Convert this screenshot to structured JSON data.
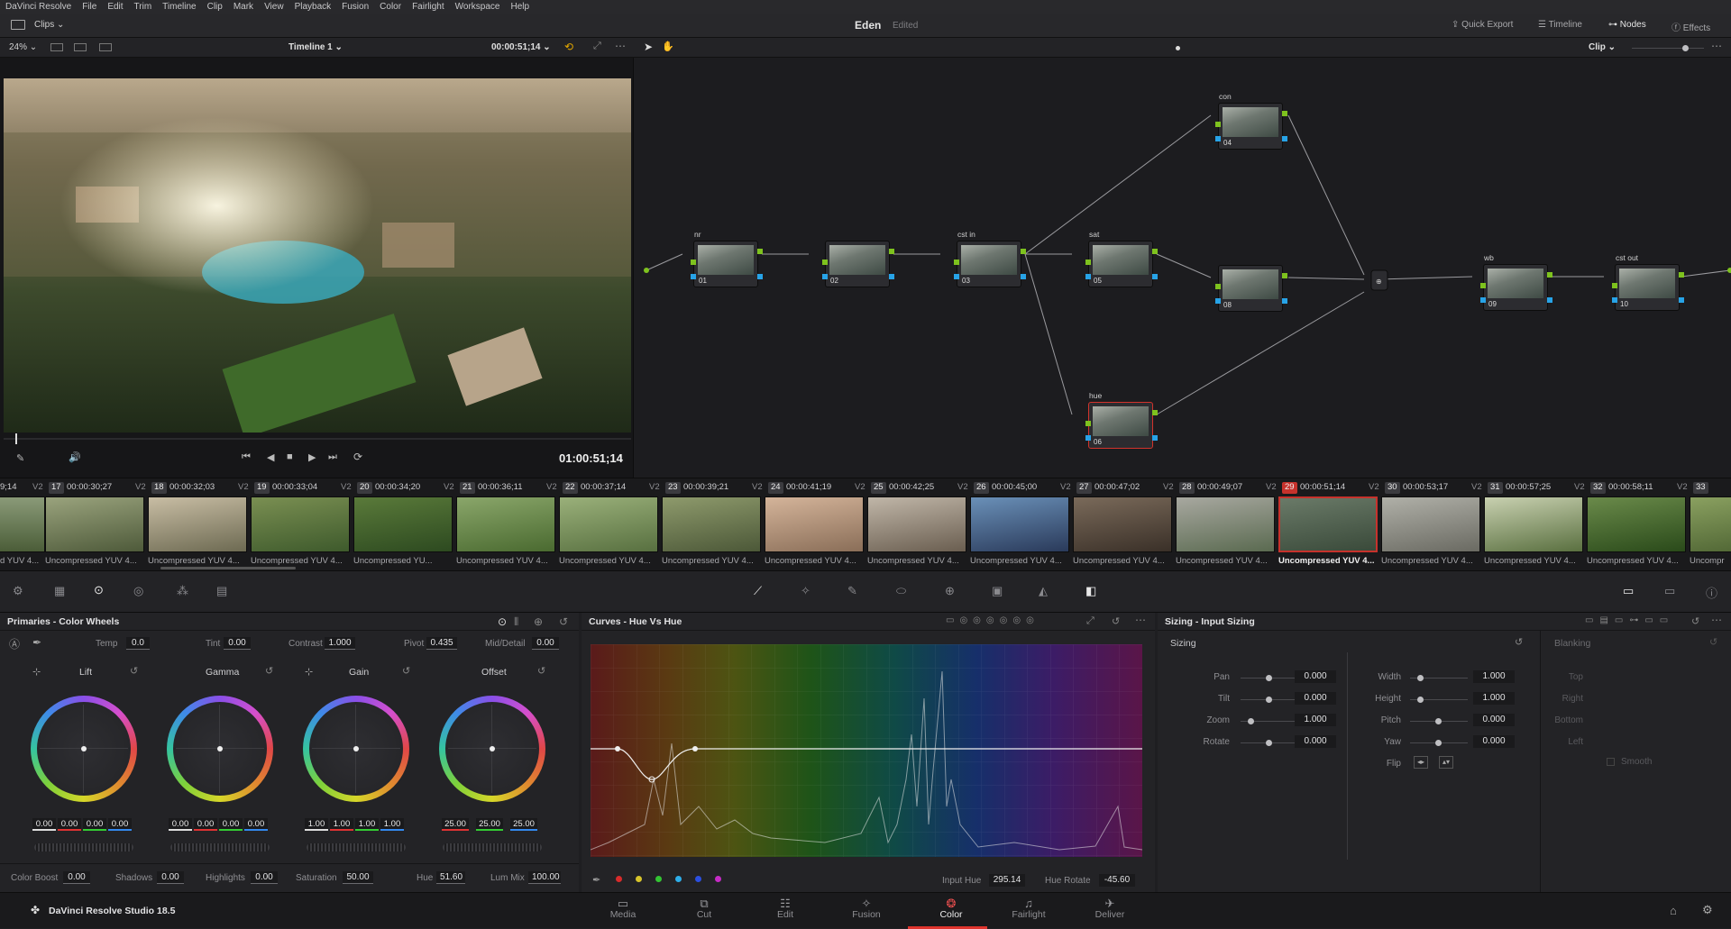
{
  "menu": [
    "DaVinci Resolve",
    "File",
    "Edit",
    "Trim",
    "Timeline",
    "Clip",
    "Mark",
    "View",
    "Playback",
    "Fusion",
    "Color",
    "Fairlight",
    "Workspace",
    "Help"
  ],
  "topbar": {
    "clips_label": "Clips",
    "project_title": "Eden",
    "project_status": "Edited",
    "quick_export": "Quick Export",
    "timeline": "Timeline",
    "nodes": "Nodes",
    "effects": "Effects"
  },
  "viewer": {
    "zoom": "24%",
    "timeline_name": "Timeline 1",
    "timecode_top": "00:00:51;14",
    "timecode_main": "01:00:51;14"
  },
  "nodebar": {
    "mode": "Clip"
  },
  "nodes": [
    {
      "id": "01",
      "name": "nr"
    },
    {
      "id": "02",
      "name": ""
    },
    {
      "id": "03",
      "name": "cst in"
    },
    {
      "id": "04",
      "name": "con"
    },
    {
      "id": "05",
      "name": "sat"
    },
    {
      "id": "06",
      "name": "hue"
    },
    {
      "id": "08",
      "name": ""
    },
    {
      "id": "09",
      "name": "wb"
    },
    {
      "id": "10",
      "name": "cst out"
    }
  ],
  "clipstrip": {
    "first_tc": "9;14",
    "clips": [
      {
        "num": "17",
        "tc": "00:00:30;27",
        "name": "Uncompressed YUV 4..."
      },
      {
        "num": "18",
        "tc": "00:00:32;03",
        "name": "Uncompressed YUV 4..."
      },
      {
        "num": "19",
        "tc": "00:00:33;04",
        "name": "Uncompressed YUV 4..."
      },
      {
        "num": "20",
        "tc": "00:00:34;20",
        "name": "Uncompressed YU..."
      },
      {
        "num": "21",
        "tc": "00:00:36;11",
        "name": "Uncompressed YUV 4..."
      },
      {
        "num": "22",
        "tc": "00:00:37;14",
        "name": "Uncompressed YUV 4..."
      },
      {
        "num": "23",
        "tc": "00:00:39;21",
        "name": "Uncompressed YUV 4..."
      },
      {
        "num": "24",
        "tc": "00:00:41;19",
        "name": "Uncompressed YUV 4..."
      },
      {
        "num": "25",
        "tc": "00:00:42;25",
        "name": "Uncompressed YUV 4..."
      },
      {
        "num": "26",
        "tc": "00:00:45;00",
        "name": "Uncompressed YUV 4..."
      },
      {
        "num": "27",
        "tc": "00:00:47;02",
        "name": "Uncompressed YUV 4..."
      },
      {
        "num": "28",
        "tc": "00:00:49;07",
        "name": "Uncompressed YUV 4..."
      },
      {
        "num": "29",
        "tc": "00:00:51;14",
        "name": "Uncompressed YUV 4..."
      },
      {
        "num": "30",
        "tc": "00:00:53;17",
        "name": "Uncompressed YUV 4..."
      },
      {
        "num": "31",
        "tc": "00:00:57;25",
        "name": "Uncompressed YUV 4..."
      },
      {
        "num": "32",
        "tc": "00:00:58;11",
        "name": "Uncompressed YUV 4..."
      },
      {
        "num": "33",
        "tc": "",
        "name": "Uncompr"
      }
    ],
    "first_clip_name": "d YUV 4...",
    "track": "V2"
  },
  "primaries": {
    "title": "Primaries - Color Wheels",
    "temp_label": "Temp",
    "temp": "0.0",
    "tint_label": "Tint",
    "tint": "0.00",
    "contrast_label": "Contrast",
    "contrast": "1.000",
    "pivot_label": "Pivot",
    "pivot": "0.435",
    "middetail_label": "Mid/Detail",
    "middetail": "0.00",
    "wheels": [
      {
        "name": "Lift",
        "values": [
          "0.00",
          "0.00",
          "0.00",
          "0.00"
        ]
      },
      {
        "name": "Gamma",
        "values": [
          "0.00",
          "0.00",
          "0.00",
          "0.00"
        ]
      },
      {
        "name": "Gain",
        "values": [
          "1.00",
          "1.00",
          "1.00",
          "1.00"
        ]
      },
      {
        "name": "Offset",
        "values": [
          "25.00",
          "25.00",
          "25.00"
        ]
      }
    ],
    "colorboost_label": "Color Boost",
    "colorboost": "0.00",
    "shadows_label": "Shadows",
    "shadows": "0.00",
    "highlights_label": "Highlights",
    "highlights": "0.00",
    "saturation_label": "Saturation",
    "saturation": "50.00",
    "hue_label": "Hue",
    "hue": "51.60",
    "lummix_label": "Lum Mix",
    "lummix": "100.00"
  },
  "curves": {
    "title": "Curves - Hue Vs Hue",
    "input_hue_label": "Input Hue",
    "input_hue": "295.14",
    "hue_rotate_label": "Hue Rotate",
    "hue_rotate": "-45.60"
  },
  "sizing": {
    "title": "Sizing - Input Sizing",
    "section": "Sizing",
    "pan_label": "Pan",
    "pan": "0.000",
    "tilt_label": "Tilt",
    "tilt": "0.000",
    "zoom_label": "Zoom",
    "zoom": "1.000",
    "rotate_label": "Rotate",
    "rotate": "0.000",
    "width_label": "Width",
    "width": "1.000",
    "height_label": "Height",
    "height": "1.000",
    "pitch_label": "Pitch",
    "pitch": "0.000",
    "yaw_label": "Yaw",
    "yaw": "0.000",
    "flip_label": "Flip",
    "blanking": "Blanking",
    "top_label": "Top",
    "right_label": "Right",
    "bottom_label": "Bottom",
    "left_label": "Left",
    "smooth_label": "Smooth"
  },
  "pagebar": {
    "brand": "DaVinci Resolve Studio 18.5",
    "tabs": [
      "Media",
      "Cut",
      "Edit",
      "Fusion",
      "Color",
      "Fairlight",
      "Deliver"
    ],
    "active": "Color"
  },
  "colors": {
    "accent": "#e0342d",
    "node_green": "#7ec21e",
    "node_blue": "#27a3e7"
  }
}
